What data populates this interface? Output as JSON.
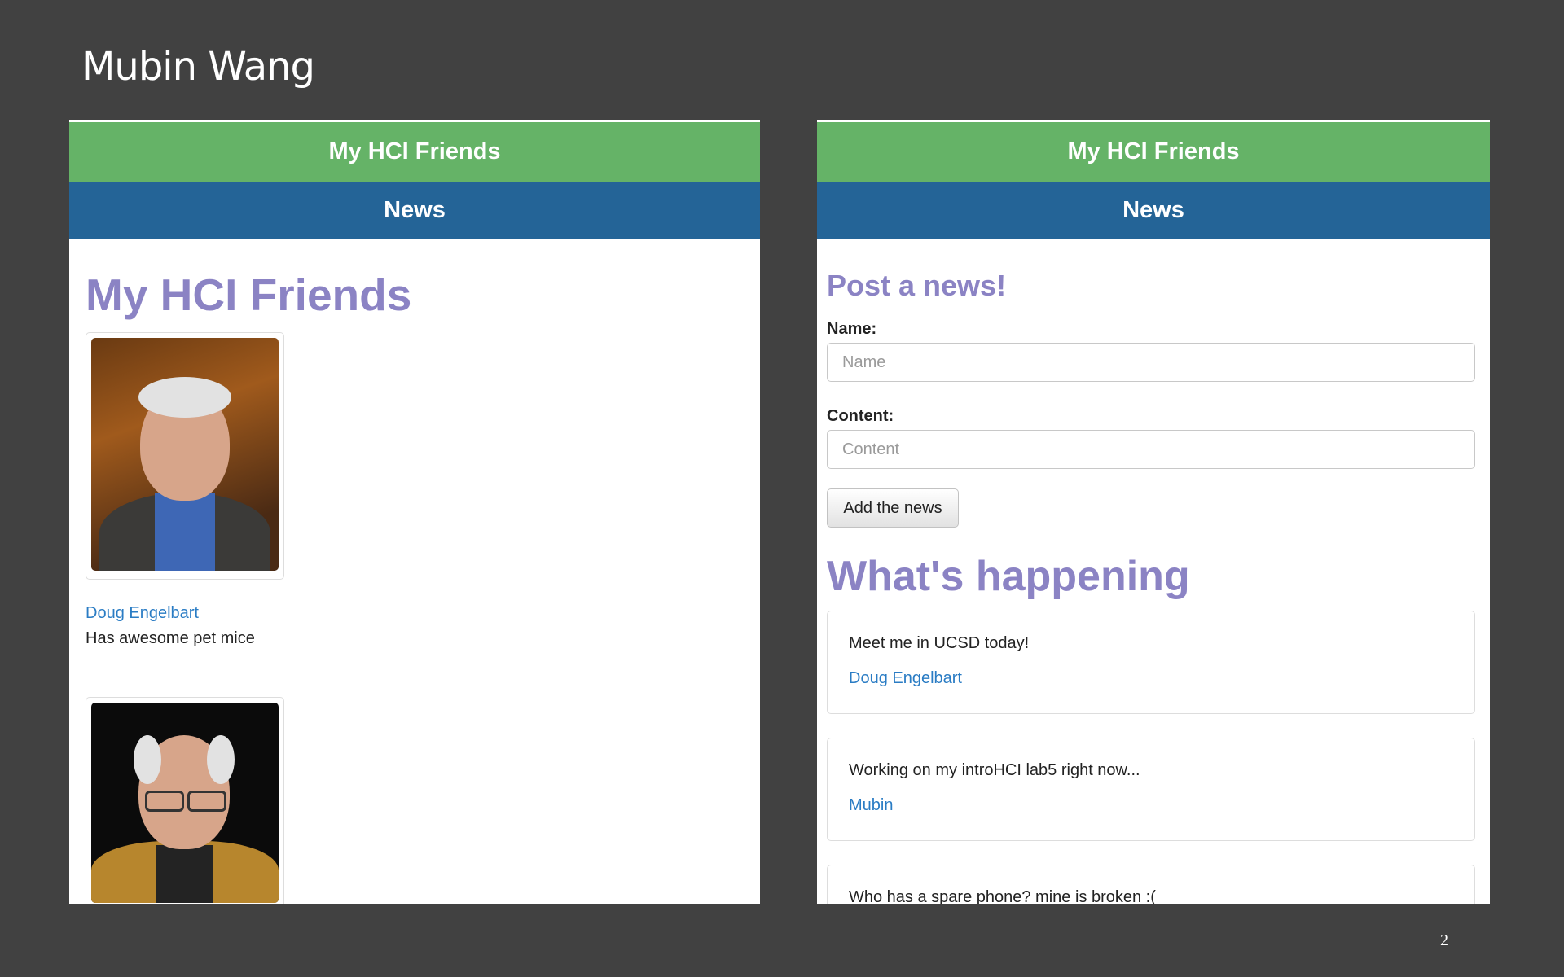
{
  "slide": {
    "title": "Mubin Wang",
    "page_number": "2"
  },
  "left_panel": {
    "header_title": "My HCI Friends",
    "nav_label": "News",
    "heading": "My HCI Friends",
    "friends": [
      {
        "name": "Doug Engelbart",
        "description": "Has awesome pet mice"
      },
      {
        "name": "",
        "description": ""
      }
    ]
  },
  "right_panel": {
    "header_title": "My HCI Friends",
    "nav_label": "News",
    "form": {
      "heading": "Post a news!",
      "name_label": "Name:",
      "name_placeholder": "Name",
      "content_label": "Content:",
      "content_placeholder": "Content",
      "submit_label": "Add the news"
    },
    "feed_heading": "What's happening",
    "news": [
      {
        "content": "Meet me in UCSD today!",
        "author": "Doug Engelbart"
      },
      {
        "content": "Working on my introHCI lab5 right now...",
        "author": "Mubin"
      },
      {
        "content": "Who has a spare phone? mine is broken :(",
        "author": ""
      }
    ]
  }
}
